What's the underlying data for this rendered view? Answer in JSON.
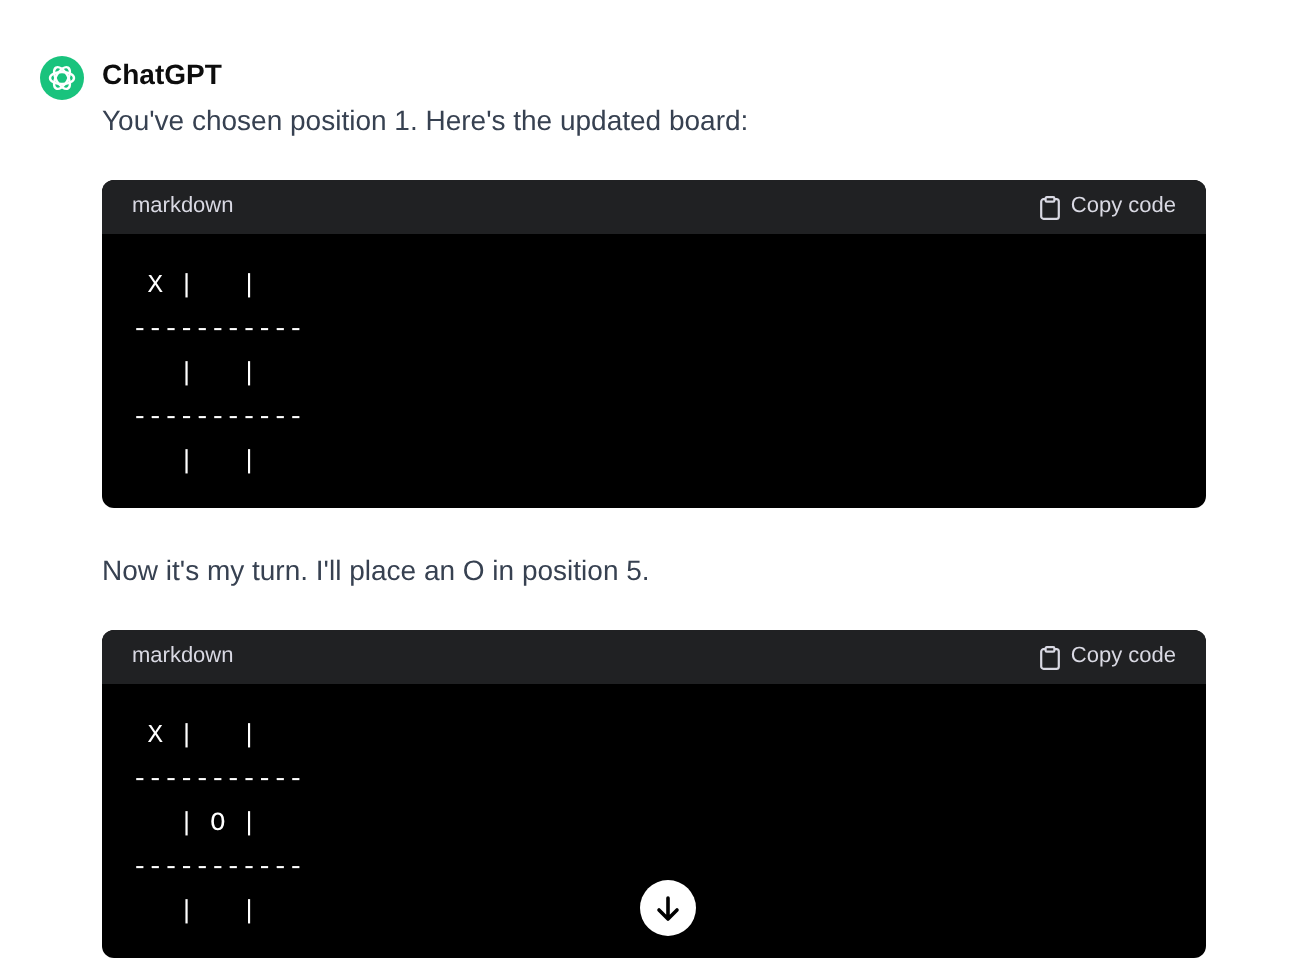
{
  "author": "ChatGPT",
  "blocks": [
    {
      "kind": "text",
      "text": "You've chosen position 1. Here's the updated board:"
    },
    {
      "kind": "code",
      "language": "markdown",
      "copy_label": "Copy code",
      "code": " X |   |\n-----------\n   |   |\n-----------\n   |   |"
    },
    {
      "kind": "text",
      "text": "Now it's my turn. I'll place an O in position 5."
    },
    {
      "kind": "code",
      "language": "markdown",
      "copy_label": "Copy code",
      "code": " X |   |\n-----------\n   | O |\n-----------\n   |   |"
    }
  ]
}
